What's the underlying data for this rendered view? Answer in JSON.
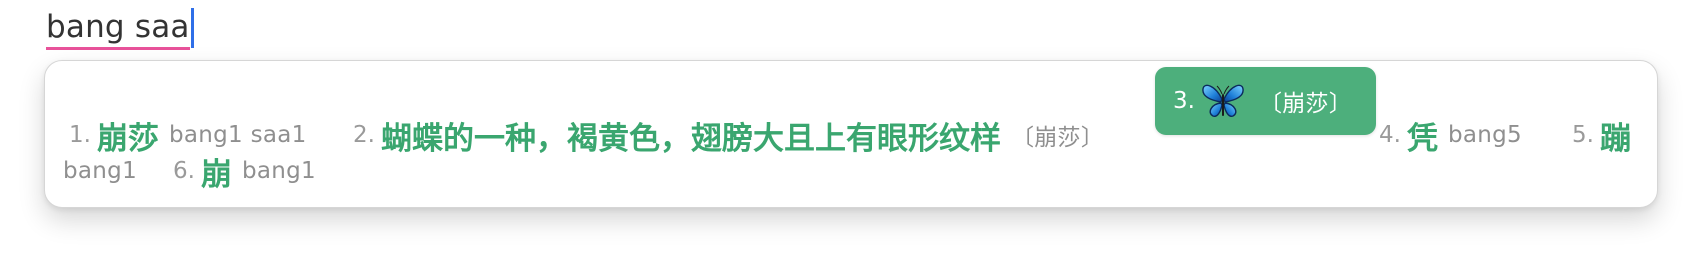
{
  "composition": {
    "preedit_text": "bang saa"
  },
  "candidates": [
    {
      "index": "1.",
      "word": "崩莎",
      "comment": "bang1  saa1",
      "selected": false
    },
    {
      "index": "2.",
      "word": "蝴蝶的一种，褐黄色，翅膀大且上有眼形纹样",
      "comment": "〔崩莎〕",
      "selected": false
    },
    {
      "index": "3.",
      "icon": "butterfly-icon",
      "comment": "〔崩莎〕",
      "selected": true
    },
    {
      "index": "4.",
      "word": "凭",
      "comment": "bang5",
      "selected": false
    },
    {
      "index": "5.",
      "word": "蹦",
      "comment": "bang1",
      "selected": false
    },
    {
      "index": "6.",
      "word": "崩",
      "comment": "bang1",
      "selected": false
    }
  ],
  "colors": {
    "accent": "#4daf7c",
    "candidate_text": "#3aa66f",
    "index_text": "#9a9a9a",
    "comment_text": "#8f8f8f",
    "preedit_underline": "#e8529a",
    "caret": "#2f6fe8"
  }
}
